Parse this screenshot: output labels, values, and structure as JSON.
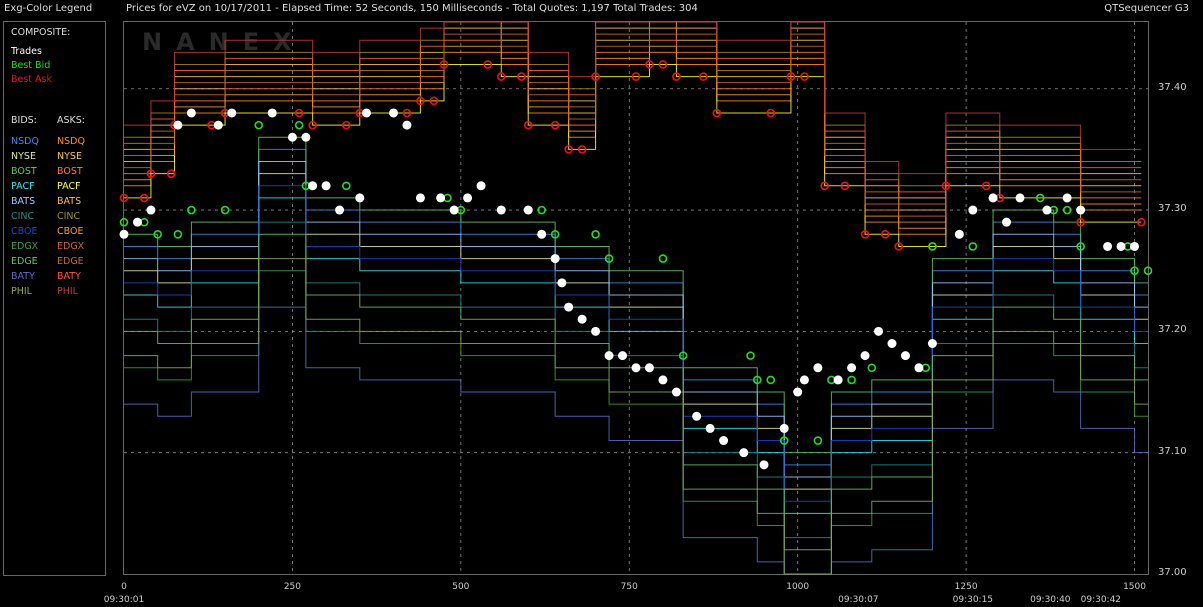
{
  "header": {
    "legend_title": "Exg-Color Legend",
    "info": "Prices for  eVZ  on 10/17/2011  -  Elapsed Time: 52 Seconds, 150 Milliseconds  -  Total Quotes: 1,197  Total Trades: 304",
    "app": "QTSequencer G3"
  },
  "legend": {
    "composite_label": "COMPOSITE:",
    "trades_label": "Trades",
    "best_bid_label": "Best Bid",
    "best_ask_label": "Best Ask",
    "bids_header": "BIDS:",
    "asks_header": "ASKS:",
    "exchanges": [
      "NSDQ",
      "NYSE",
      "BOST",
      "PACF",
      "BATS",
      "CINC",
      "CBOE",
      "EDGX",
      "EDGE",
      "BATY",
      "PHIL"
    ],
    "bid_colors": [
      "#3c8ce8",
      "#e6e6a0",
      "#64c864",
      "#32e6f0",
      "#a0c8ff",
      "#1e8c8c",
      "#1e46c8",
      "#3ca03c",
      "#6ebe6e",
      "#5a6ec8",
      "#8caa5a"
    ],
    "ask_colors": [
      "#ff8c1e",
      "#ffc850",
      "#ff783c",
      "#ffff3c",
      "#ffbe5a",
      "#a08c1e",
      "#ff9628",
      "#c8643c",
      "#c86e1e",
      "#ff5a3c",
      "#be3c3c"
    ]
  },
  "colors": {
    "trades": "#ffffff",
    "best_bid": "#22dd22",
    "best_ask": "#ee1111",
    "grid": "#8c8c8c",
    "background": "#000000"
  },
  "watermark": "NANEX",
  "chart_data": {
    "type": "line",
    "title": "Prices for eVZ on 10/17/2011",
    "xlim": [
      0,
      1520
    ],
    "ylim": [
      37.0,
      37.455
    ],
    "y_ticks": [
      "37.40",
      "37.30",
      "37.20",
      "37.10",
      "37.00"
    ],
    "y_tick_values": [
      37.4,
      37.3,
      37.2,
      37.1,
      37.0
    ],
    "x_ticks": [
      "0",
      "250",
      "500",
      "750",
      "1000",
      "1250",
      "1500"
    ],
    "x_tick_values": [
      0,
      250,
      500,
      750,
      1000,
      1250,
      1500
    ],
    "time_labels": [
      {
        "x": 0,
        "label": "09:30:01"
      },
      {
        "x": 1090,
        "label": "09:30:07"
      },
      {
        "x": 1260,
        "label": "09:30:15"
      },
      {
        "x": 1375,
        "label": "09:30:40"
      },
      {
        "x": 1450,
        "label": "09:30:42"
      }
    ],
    "series": [
      {
        "name": "Best Ask",
        "points": [
          [
            0,
            37.31
          ],
          [
            30,
            37.31
          ],
          [
            40,
            37.33
          ],
          [
            70,
            37.33
          ],
          [
            75,
            37.37
          ],
          [
            130,
            37.37
          ],
          [
            150,
            37.38
          ],
          [
            260,
            37.38
          ],
          [
            280,
            37.37
          ],
          [
            330,
            37.37
          ],
          [
            350,
            37.38
          ],
          [
            420,
            37.38
          ],
          [
            440,
            37.39
          ],
          [
            460,
            37.39
          ],
          [
            475,
            37.42
          ],
          [
            540,
            37.42
          ],
          [
            560,
            37.41
          ],
          [
            590,
            37.41
          ],
          [
            600,
            37.37
          ],
          [
            640,
            37.37
          ],
          [
            660,
            37.35
          ],
          [
            680,
            37.35
          ],
          [
            700,
            37.41
          ],
          [
            760,
            37.41
          ],
          [
            780,
            37.42
          ],
          [
            800,
            37.42
          ],
          [
            820,
            37.41
          ],
          [
            860,
            37.41
          ],
          [
            880,
            37.38
          ],
          [
            960,
            37.38
          ],
          [
            990,
            37.41
          ],
          [
            1010,
            37.41
          ],
          [
            1040,
            37.32
          ],
          [
            1070,
            37.32
          ],
          [
            1100,
            37.28
          ],
          [
            1130,
            37.28
          ],
          [
            1150,
            37.27
          ],
          [
            1200,
            37.27
          ],
          [
            1220,
            37.32
          ],
          [
            1280,
            37.32
          ],
          [
            1300,
            37.31
          ],
          [
            1400,
            37.31
          ],
          [
            1420,
            37.29
          ],
          [
            1510,
            37.29
          ]
        ]
      },
      {
        "name": "Best Bid",
        "points": [
          [
            0,
            37.29
          ],
          [
            30,
            37.29
          ],
          [
            50,
            37.28
          ],
          [
            80,
            37.28
          ],
          [
            100,
            37.3
          ],
          [
            150,
            37.3
          ],
          [
            200,
            37.37
          ],
          [
            260,
            37.37
          ],
          [
            270,
            37.32
          ],
          [
            330,
            37.32
          ],
          [
            350,
            37.31
          ],
          [
            480,
            37.31
          ],
          [
            500,
            37.3
          ],
          [
            620,
            37.3
          ],
          [
            640,
            37.28
          ],
          [
            700,
            37.28
          ],
          [
            720,
            37.26
          ],
          [
            800,
            37.26
          ],
          [
            830,
            37.18
          ],
          [
            930,
            37.18
          ],
          [
            940,
            37.16
          ],
          [
            960,
            37.16
          ],
          [
            980,
            37.11
          ],
          [
            1030,
            37.11
          ],
          [
            1050,
            37.16
          ],
          [
            1060,
            37.16
          ],
          [
            1080,
            37.16
          ],
          [
            1110,
            37.17
          ],
          [
            1190,
            37.17
          ],
          [
            1200,
            37.27
          ],
          [
            1260,
            37.27
          ],
          [
            1290,
            37.31
          ],
          [
            1360,
            37.31
          ],
          [
            1380,
            37.3
          ],
          [
            1400,
            37.3
          ],
          [
            1420,
            37.27
          ],
          [
            1490,
            37.27
          ],
          [
            1500,
            37.25
          ],
          [
            1520,
            37.25
          ]
        ]
      },
      {
        "name": "Trades",
        "points": [
          [
            0,
            37.28
          ],
          [
            20,
            37.29
          ],
          [
            40,
            37.3
          ],
          [
            80,
            37.37
          ],
          [
            100,
            37.38
          ],
          [
            140,
            37.37
          ],
          [
            160,
            37.38
          ],
          [
            220,
            37.38
          ],
          [
            250,
            37.36
          ],
          [
            270,
            37.36
          ],
          [
            280,
            37.32
          ],
          [
            300,
            37.32
          ],
          [
            320,
            37.3
          ],
          [
            350,
            37.31
          ],
          [
            360,
            37.38
          ],
          [
            400,
            37.38
          ],
          [
            420,
            37.37
          ],
          [
            440,
            37.31
          ],
          [
            470,
            37.31
          ],
          [
            490,
            37.3
          ],
          [
            510,
            37.31
          ],
          [
            530,
            37.32
          ],
          [
            560,
            37.3
          ],
          [
            600,
            37.3
          ],
          [
            620,
            37.28
          ],
          [
            640,
            37.26
          ],
          [
            650,
            37.24
          ],
          [
            660,
            37.22
          ],
          [
            680,
            37.21
          ],
          [
            700,
            37.2
          ],
          [
            720,
            37.18
          ],
          [
            740,
            37.18
          ],
          [
            760,
            37.17
          ],
          [
            780,
            37.17
          ],
          [
            800,
            37.16
          ],
          [
            820,
            37.15
          ],
          [
            850,
            37.13
          ],
          [
            870,
            37.12
          ],
          [
            890,
            37.11
          ],
          [
            920,
            37.1
          ],
          [
            950,
            37.09
          ],
          [
            980,
            37.12
          ],
          [
            1000,
            37.15
          ],
          [
            1010,
            37.16
          ],
          [
            1030,
            37.17
          ],
          [
            1060,
            37.16
          ],
          [
            1080,
            37.17
          ],
          [
            1100,
            37.18
          ],
          [
            1120,
            37.2
          ],
          [
            1140,
            37.19
          ],
          [
            1160,
            37.18
          ],
          [
            1180,
            37.17
          ],
          [
            1200,
            37.19
          ],
          [
            1240,
            37.28
          ],
          [
            1260,
            37.3
          ],
          [
            1290,
            37.31
          ],
          [
            1310,
            37.29
          ],
          [
            1330,
            37.31
          ],
          [
            1370,
            37.3
          ],
          [
            1400,
            37.31
          ],
          [
            1420,
            37.3
          ],
          [
            1460,
            37.27
          ],
          [
            1480,
            37.27
          ],
          [
            1500,
            37.27
          ]
        ]
      }
    ]
  }
}
